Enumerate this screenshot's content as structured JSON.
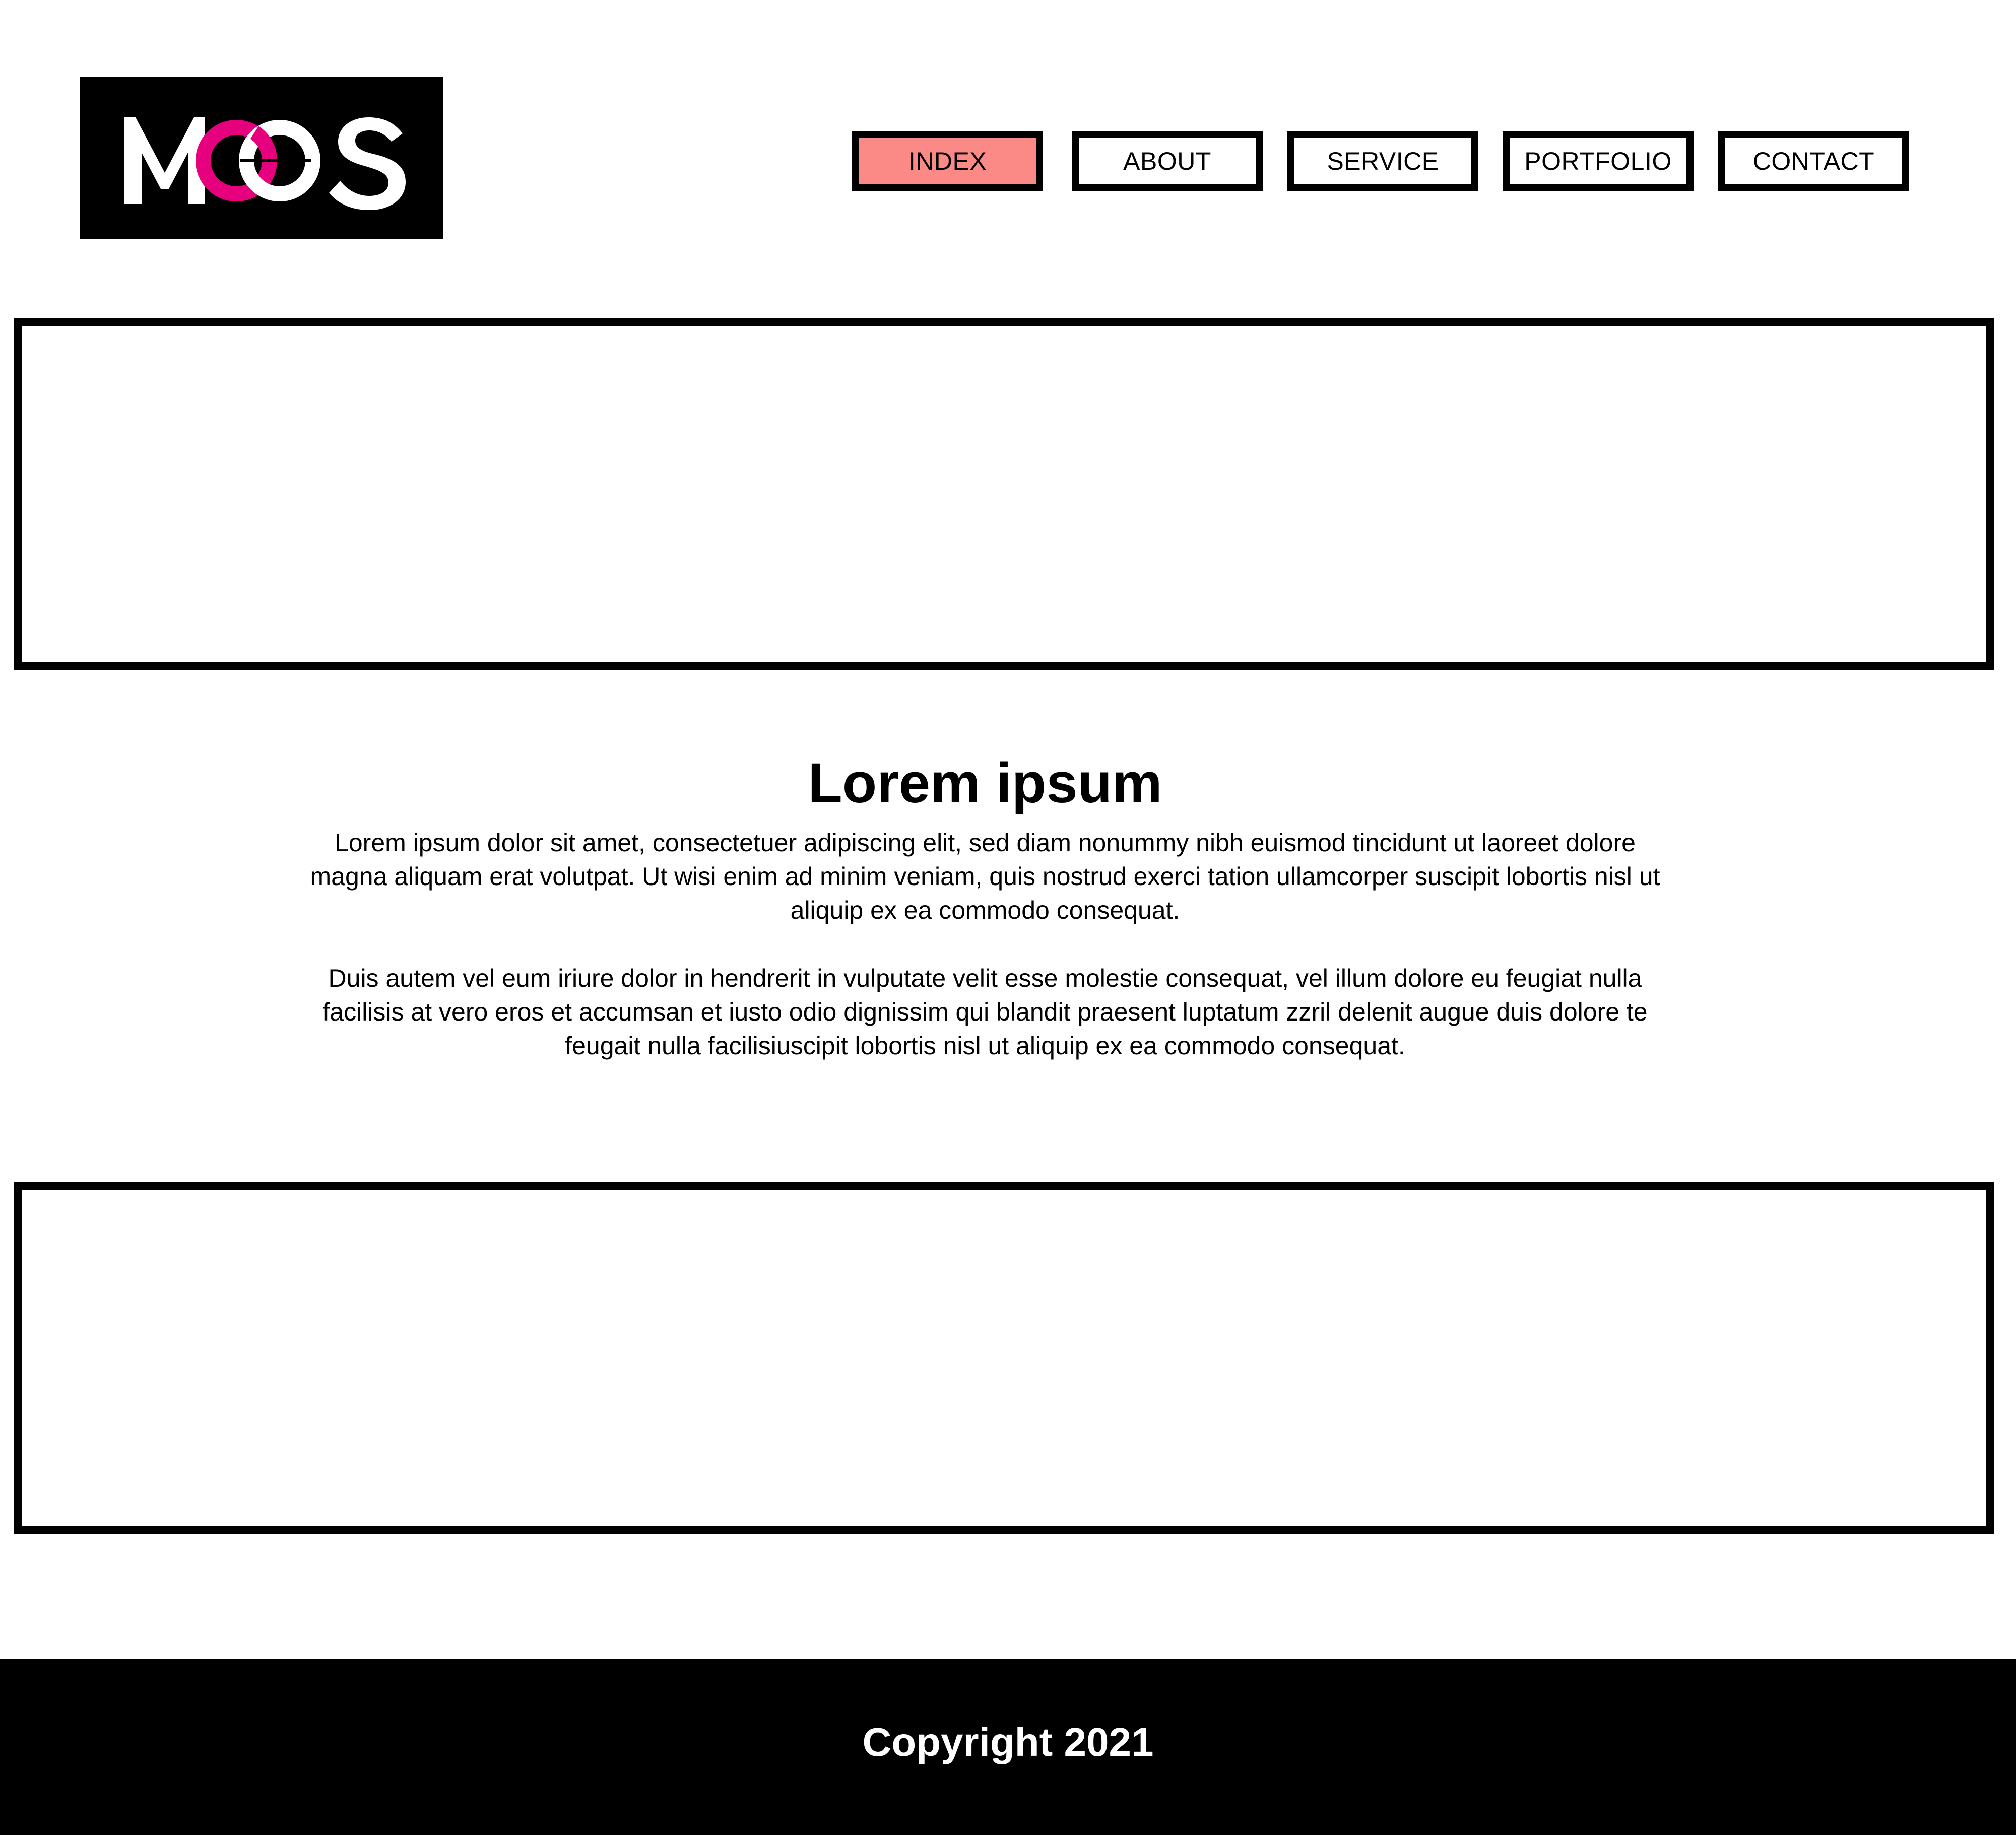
{
  "logo": {
    "text": "MOOS",
    "accent_color": "#e6007e"
  },
  "nav": {
    "items": [
      {
        "label": "INDEX",
        "active": true
      },
      {
        "label": "ABOUT",
        "active": false
      },
      {
        "label": "SERVICE",
        "active": false
      },
      {
        "label": "PORTFOLIO",
        "active": false
      },
      {
        "label": "CONTACT",
        "active": false
      }
    ],
    "active_color": "#fb8a86"
  },
  "main": {
    "heading": "Lorem ipsum",
    "paragraph_1": "Lorem ipsum dolor sit amet, consectetuer adipiscing elit, sed diam nonummy nibh euismod tincidunt ut laoreet dolore magna aliquam erat volutpat. Ut wisi enim ad minim veniam, quis nostrud exerci tation ullamcorper suscipit lobortis nisl ut aliquip ex ea commodo consequat.",
    "paragraph_2": "Duis autem vel eum iriure dolor in hendrerit in vulputate velit esse molestie consequat, vel illum dolore eu feugiat nulla facilisis at vero eros et accumsan et iusto odio dignissim qui blandit praesent luptatum zzril delenit augue duis dolore te feugait nulla facilisiuscipit lobortis nisl ut aliquip ex ea commodo consequat."
  },
  "footer": {
    "copyright": "Copyright 2021"
  }
}
